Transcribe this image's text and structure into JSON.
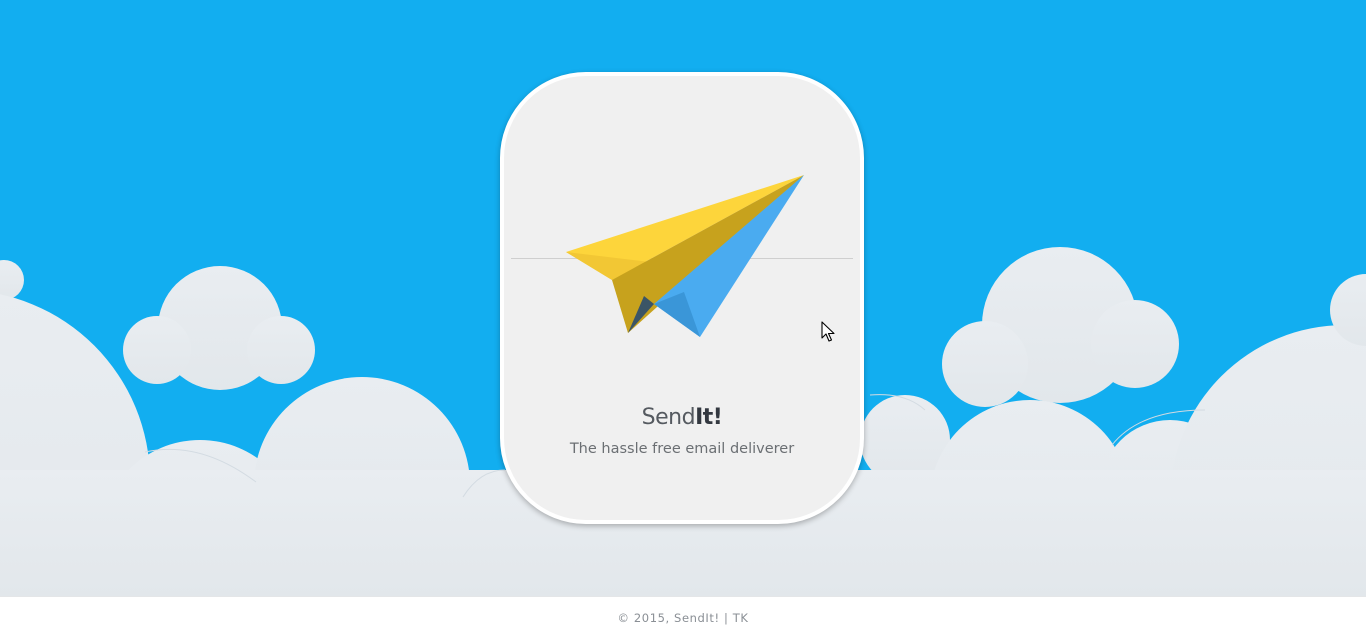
{
  "app": {
    "brand_light": "Send",
    "brand_bold": "It!",
    "tagline": "The hassle free email deliverer"
  },
  "footer": {
    "text": "© 2015, SendIt! | TK"
  },
  "colors": {
    "sky": "#12aef0",
    "cloud": "#e6ebef",
    "card_background": "#f0f0f0",
    "plane_yellow": "#fdd53b",
    "plane_blue": "#4aabf0"
  },
  "icons": {
    "logo": "paper-plane-icon",
    "pointer": "mouse-cursor-icon"
  }
}
